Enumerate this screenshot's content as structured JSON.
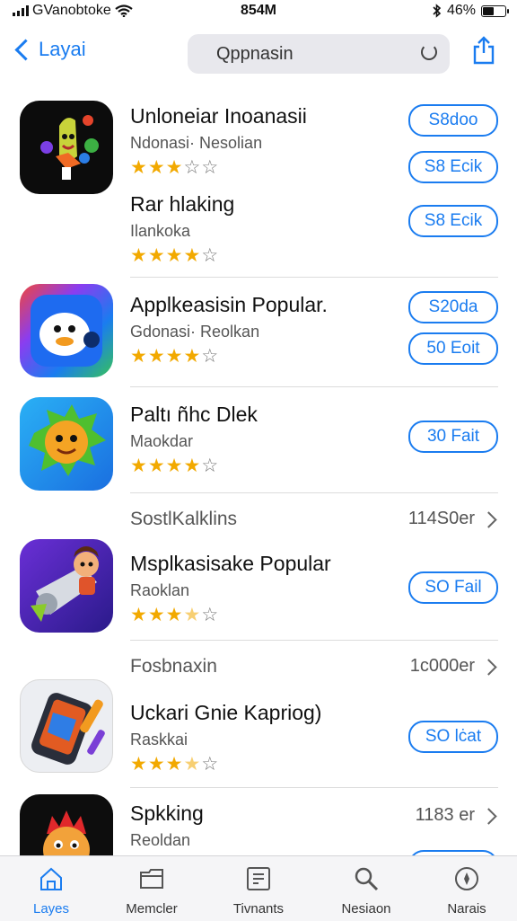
{
  "status": {
    "carrier": "GVanobtoke",
    "time": "854M",
    "battery": "46%",
    "battery_level": 0.46
  },
  "nav": {
    "back_label": "Layai",
    "search_text": "Qppnasin"
  },
  "apps": [
    {
      "title": "Unloneiar Inoanasii",
      "subtitle": "Ndonasi· Nesolian",
      "rating": 3,
      "price": "S8doo"
    },
    {
      "title": "Rar hlaking",
      "subtitle": "Ilankoka",
      "rating": 4,
      "price": "S8 Ecik"
    },
    {
      "title": "Applkeasisin Popular.",
      "subtitle": "Gdonasi· Reolkan",
      "rating": 4,
      "price": "S20da"
    },
    {
      "title": "Paltı ñhc Dlek",
      "subtitle": "Maokdar",
      "rating": 4,
      "price": "30 Fait"
    },
    {
      "title": "Msplkasisake Popular",
      "subtitle": "Raoklan",
      "rating": 3.5,
      "price": "SO Fail"
    },
    {
      "title": "Uckari Gnie Kapriog)",
      "subtitle": "Raskkai",
      "rating": 3.5,
      "price": "SO lċat"
    },
    {
      "title": "Spkking",
      "subtitle": "Reoldan",
      "rating": 0,
      "price": ""
    }
  ],
  "extra_price": "50 Eoit",
  "sections": [
    {
      "title": "SostlKalklins",
      "count": "114S0er"
    },
    {
      "title": "Fosbnaxin",
      "count": "1c000er"
    },
    {
      "title": "",
      "count": "1183 er"
    }
  ],
  "tabs": [
    {
      "label": "Layes",
      "icon": "home-icon",
      "active": true
    },
    {
      "label": "Memcler",
      "icon": "folder-icon",
      "active": false
    },
    {
      "label": "Tivnants",
      "icon": "list-icon",
      "active": false
    },
    {
      "label": "Nesiaon",
      "icon": "search-icon",
      "active": false
    },
    {
      "label": "Narais",
      "icon": "compass-icon",
      "active": false
    }
  ],
  "colors": {
    "accent": "#1a7cf0",
    "star": "#f2a900",
    "tab_bar_bg": "#f5f5f7"
  }
}
